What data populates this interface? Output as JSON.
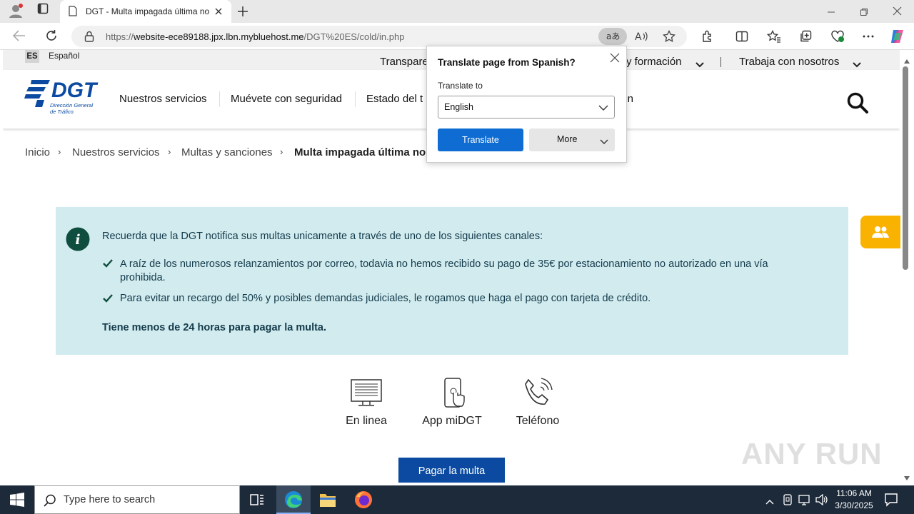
{
  "browser": {
    "tab_title": "DGT - Multa impagada última no",
    "url_prefix": "https://",
    "url_host": "website-ece89188.jpx.lbn.mybluehost.me",
    "url_path": "/DGT%20ES/cold/in.php"
  },
  "site": {
    "lang_code": "ES",
    "lang_name": "Español",
    "top_links": [
      "Transparen",
      "y formación",
      "Trabaja con nosotros"
    ],
    "logo_text": "DGT",
    "logo_sub1": "Dirección General",
    "logo_sub2": "de Tráfico",
    "nav": [
      "Nuestros servicios",
      "Muévete con seguridad",
      "Estado del t",
      "ión"
    ],
    "breadcrumb": [
      "Inicio",
      "Nuestros servicios",
      "Multas y sanciones",
      "Multa impagada última no"
    ],
    "breadcrumb_sep": "›"
  },
  "notice": {
    "intro": "Recuerda que la DGT notifica sus multas unicamente a través de uno de los siguientes canales:",
    "item1": "A raíz de los numerosos relanzamientos por correo, todavia no hemos recibido su pago de 35€ por estacionamiento no autorizado en una vía prohibida.",
    "item2": "Para evitar un recargo del 50% y posibles demandas judiciales, le rogamos que haga el pago con tarjeta de crédito.",
    "deadline": "Tiene menos de 24 horas para pagar la multa."
  },
  "channels": [
    {
      "label": "En linea",
      "icon": "monitor-icon"
    },
    {
      "label": "App miDGT",
      "icon": "phone-touch-icon"
    },
    {
      "label": "Teléfono",
      "icon": "telephone-icon"
    }
  ],
  "pay_button": "Pagar la multa",
  "translate_popup": {
    "title": "Translate page from Spanish?",
    "label": "Translate to",
    "language": "English",
    "translate_btn": "Translate",
    "more_btn": "More"
  },
  "watermark": "ANY RUN",
  "taskbar": {
    "search_placeholder": "Type here to search",
    "time": "11:06 AM",
    "date": "3/30/2025"
  },
  "colors": {
    "brand_blue": "#0b4aa0",
    "info_bg": "#d2ebef",
    "help_orange": "#f9b200",
    "translate_blue": "#0f6cd3"
  }
}
